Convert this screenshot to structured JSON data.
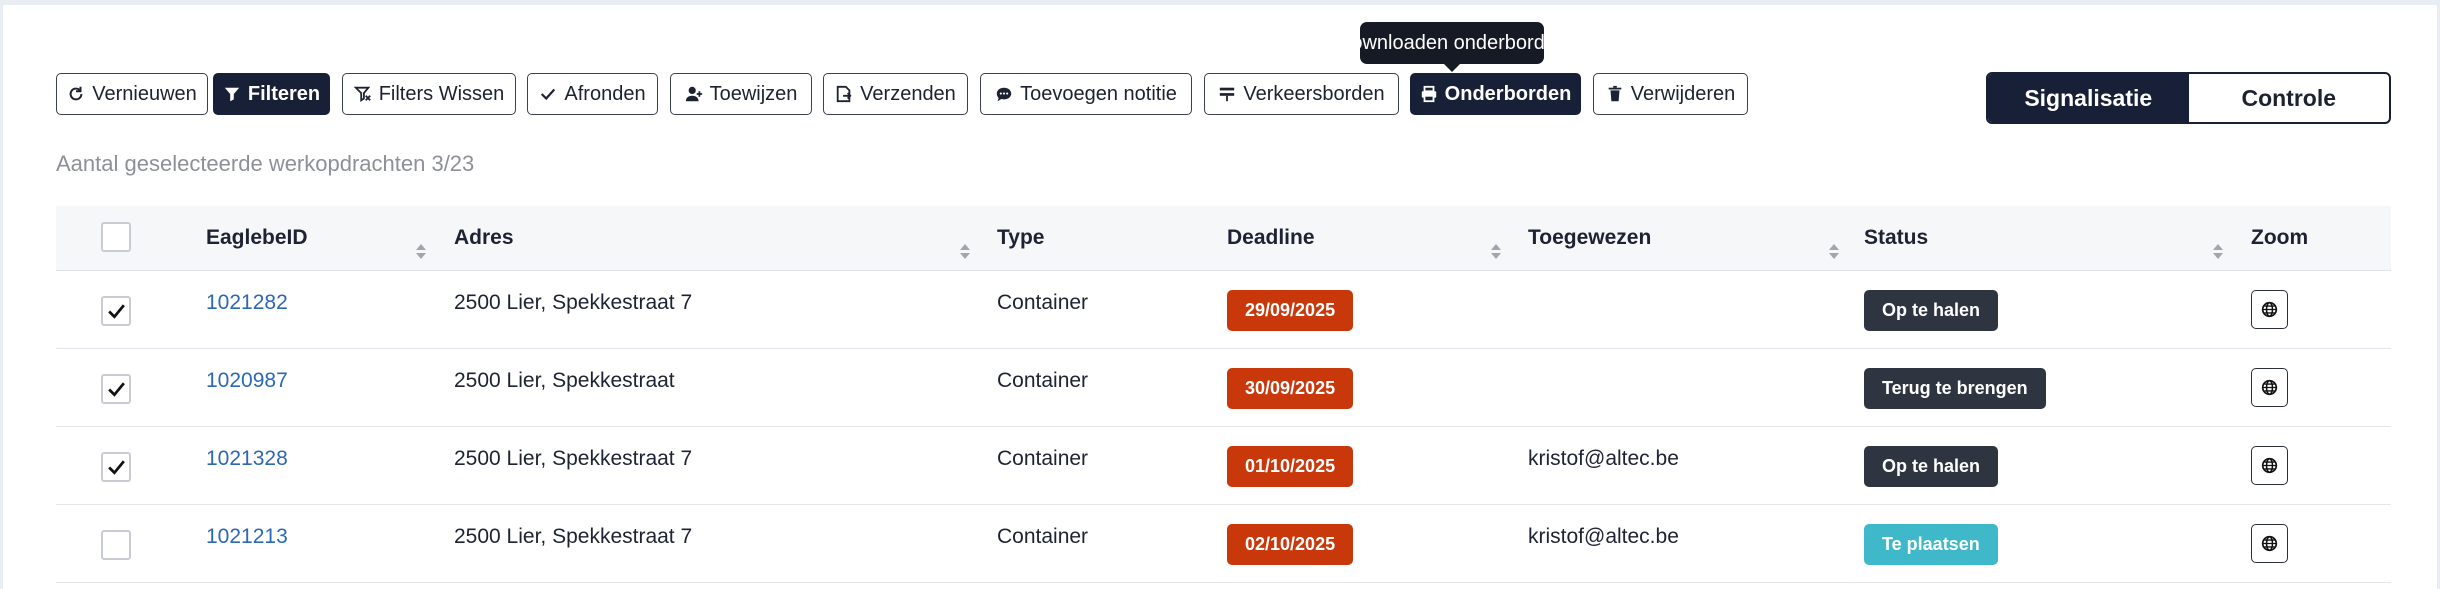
{
  "toolbar": {
    "buttons": [
      {
        "label": "Vernieuwen",
        "icon": "refresh-icon"
      },
      {
        "label": "Filteren",
        "icon": "filter-icon"
      },
      {
        "label": "Filters Wissen",
        "icon": "filter-clear-icon"
      },
      {
        "label": "Afronden",
        "icon": "check-icon"
      },
      {
        "label": "Toewijzen",
        "icon": "user-add-icon"
      },
      {
        "label": "Verzenden",
        "icon": "send-file-icon"
      },
      {
        "label": "Toevoegen notitie",
        "icon": "comment-icon"
      },
      {
        "label": "Verkeersborden",
        "icon": "sign-icon"
      },
      {
        "label": "Onderborden",
        "icon": "print-icon"
      },
      {
        "label": "Verwijderen",
        "icon": "trash-icon"
      }
    ],
    "tooltip": "Downloaden onderborden"
  },
  "view_toggle": {
    "options": [
      "Signalisatie",
      "Controle"
    ],
    "selected": "Signalisatie"
  },
  "selection_count": "Aantal geselecteerde werkopdrachten 3/23",
  "table": {
    "headers": [
      "EaglebeID",
      "Adres",
      "Type",
      "Deadline",
      "Toegewezen",
      "Status",
      "Zoom"
    ],
    "rows": [
      {
        "checked": true,
        "id": "1021282",
        "address": "2500 Lier, Spekkestraat 7",
        "type": "Container",
        "deadline": "29/09/2025",
        "assigned": "",
        "status": "Op te halen",
        "status_color": "#2f3441"
      },
      {
        "checked": true,
        "id": "1020987",
        "address": "2500 Lier, Spekkestraat",
        "type": "Container",
        "deadline": "30/09/2025",
        "assigned": "",
        "status": "Terug te brengen",
        "status_color": "#2f3441"
      },
      {
        "checked": true,
        "id": "1021328",
        "address": "2500 Lier, Spekkestraat 7",
        "type": "Container",
        "deadline": "01/10/2025",
        "assigned": "kristof@altec.be",
        "status": "Op te halen",
        "status_color": "#2f3441"
      },
      {
        "checked": false,
        "id": "1021213",
        "address": "2500 Lier, Spekkestraat 7",
        "type": "Container",
        "deadline": "02/10/2025",
        "assigned": "kristof@altec.be",
        "status": "Te plaatsen",
        "status_color": "#3fb8c9"
      }
    ]
  },
  "colors": {
    "primary": "#172036",
    "deadline_badge": "#c9380b",
    "link": "#2b68b5"
  }
}
